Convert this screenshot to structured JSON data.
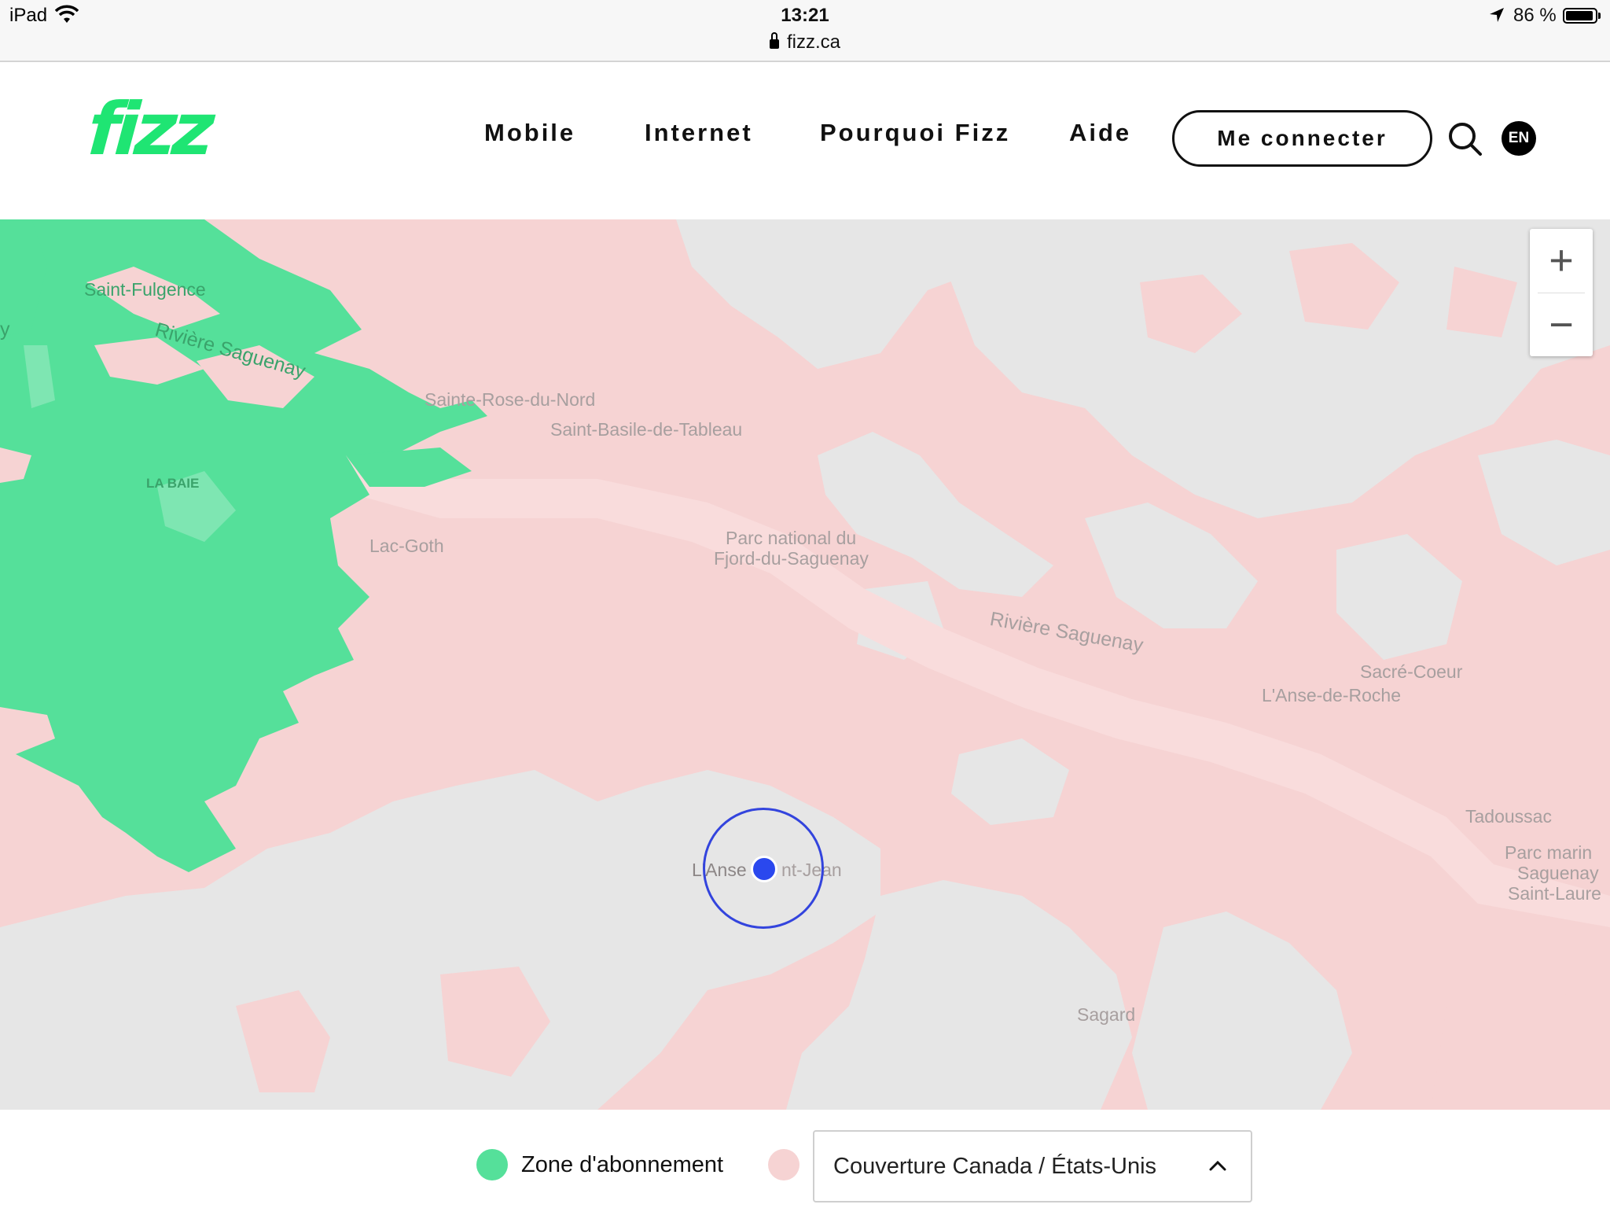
{
  "status_bar": {
    "device": "iPad",
    "time": "13:21",
    "url": "fizz.ca",
    "battery": "86 %"
  },
  "header": {
    "logo": "fizz",
    "nav": [
      "Mobile",
      "Internet",
      "Pourquoi Fizz",
      "Aide"
    ],
    "login_label": "Me connecter",
    "lang_label": "EN"
  },
  "map": {
    "labels": {
      "saint_fulgence": "Saint-Fulgence",
      "riviere_saguenay_1": "Rivière Saguenay",
      "sainte_rose": "Sainte-Rose-du-Nord",
      "saint_basile": "Saint-Basile-de-Tableau",
      "la_baie": "LA BAIE",
      "lac_goth": "Lac-Goth",
      "parc_fjord_1": "Parc national du",
      "parc_fjord_2": "Fjord-du-Saguenay",
      "riviere_saguenay_2": "Rivière Saguenay",
      "sacre_coeur": "Sacré-Coeur",
      "anse_de_roche": "L'Anse-de-Roche",
      "tadoussac": "Tadoussac",
      "parc_marin_1": "Parc marin",
      "parc_marin_2": "Saguenay",
      "parc_marin_3": "Saint-Laure",
      "lanse": "L'Anse",
      "saint_jean": "nt-Jean",
      "sagard": "Sagard",
      "edge_y": "y"
    },
    "zoom_in": "+",
    "zoom_out": "−",
    "colors": {
      "subscription_zone": "#55e09a",
      "coverage": "#f6d3d3",
      "land": "#e6e6e6",
      "location": "#2a48ee"
    }
  },
  "legend": {
    "subscription_label": "Zone d'abonnement",
    "coverage_select_value": "Couverture Canada / États-Unis"
  }
}
